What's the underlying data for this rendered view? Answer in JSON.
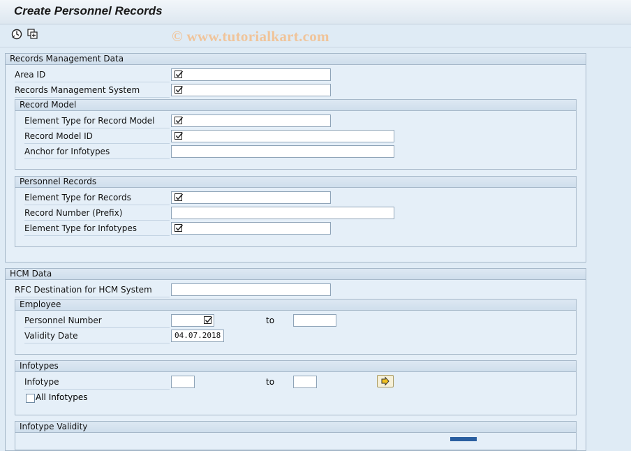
{
  "window": {
    "title": "Create Personnel Records"
  },
  "toolbar": {
    "icons": [
      "execute-icon",
      "get-variant-icon"
    ]
  },
  "watermark": "© www.tutorialkart.com",
  "records_management": {
    "title": "Records Management Data",
    "area_id_label": "Area ID",
    "rms_label": "Records Management System",
    "record_model": {
      "title": "Record Model",
      "element_type_label": "Element Type for Record Model",
      "record_model_id_label": "Record Model ID",
      "anchor_label": "Anchor for Infotypes"
    },
    "personnel_records": {
      "title": "Personnel Records",
      "element_type_records_label": "Element Type for Records",
      "record_number_label": "Record Number (Prefix)",
      "element_type_infotypes_label": "Element Type for Infotypes"
    }
  },
  "hcm": {
    "title": "HCM Data",
    "rfc_label": "RFC Destination for HCM System",
    "employee": {
      "title": "Employee",
      "personnel_number_label": "Personnel Number",
      "to_label": "to",
      "validity_date_label": "Validity Date",
      "validity_date_value": "04.07.2018"
    },
    "infotypes": {
      "title": "Infotypes",
      "infotype_label": "Infotype",
      "to_label": "to",
      "all_infotypes_label": "All Infotypes"
    },
    "infotype_validity": {
      "title": "Infotype Validity"
    }
  }
}
